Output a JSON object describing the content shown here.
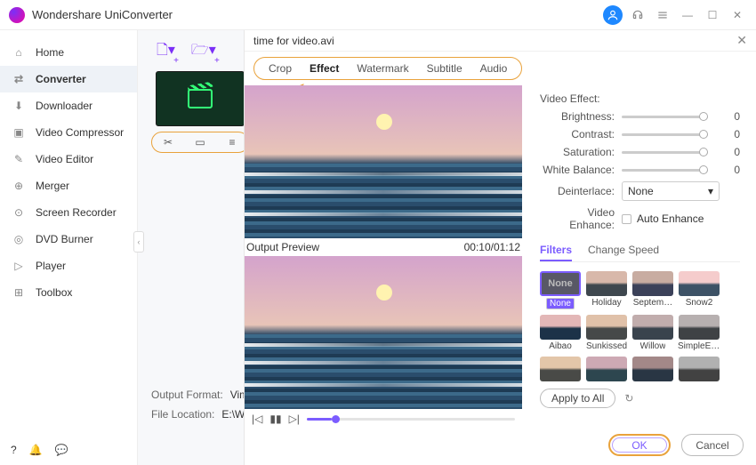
{
  "app": {
    "title": "Wondershare UniConverter"
  },
  "window_buttons": {
    "minimize": "—",
    "maximize": "☐",
    "close": "✕"
  },
  "sidebar": {
    "items": [
      {
        "label": "Home"
      },
      {
        "label": "Converter"
      },
      {
        "label": "Downloader"
      },
      {
        "label": "Video Compressor"
      },
      {
        "label": "Video Editor"
      },
      {
        "label": "Merger"
      },
      {
        "label": "Screen Recorder"
      },
      {
        "label": "DVD Burner"
      },
      {
        "label": "Player"
      },
      {
        "label": "Toolbox"
      }
    ]
  },
  "filecard": {
    "tools": {
      "cut": "✂",
      "crop": "▭",
      "more": "≡"
    }
  },
  "output": {
    "format_label": "Output Format:",
    "format_value": "Vimeo",
    "location_label": "File Location:",
    "location_value": "E:\\Won"
  },
  "modal": {
    "filename": "time for video.avi",
    "close": "✕",
    "tabs": {
      "crop": "Crop",
      "effect": "Effect",
      "watermark": "Watermark",
      "subtitle": "Subtitle",
      "audio": "Audio"
    },
    "preview_label": "Output Preview",
    "time": "00:10/01:12",
    "controls": {
      "prev": "|◁",
      "pause": "▮▮",
      "next": "▷|"
    },
    "video_effect_label": "Video Effect:",
    "sliders": {
      "brightness": {
        "label": "Brightness:",
        "value": "0"
      },
      "contrast": {
        "label": "Contrast:",
        "value": "0"
      },
      "saturation": {
        "label": "Saturation:",
        "value": "0"
      },
      "white_balance": {
        "label": "White Balance:",
        "value": "0"
      }
    },
    "deinterlace": {
      "label": "Deinterlace:",
      "value": "None"
    },
    "enhance": {
      "label": "Video Enhance:",
      "option": "Auto Enhance"
    },
    "subtabs": {
      "filters": "Filters",
      "change_speed": "Change Speed"
    },
    "filters": {
      "none": "None",
      "row1": [
        "None",
        "Holiday",
        "Septem…",
        "Snow2"
      ],
      "row2": [
        "Aibao",
        "Sunkissed",
        "Willow",
        "SimpleEl…"
      ]
    },
    "apply_all": "Apply to All",
    "reset": "↻",
    "ok": "OK",
    "cancel": "Cancel"
  }
}
